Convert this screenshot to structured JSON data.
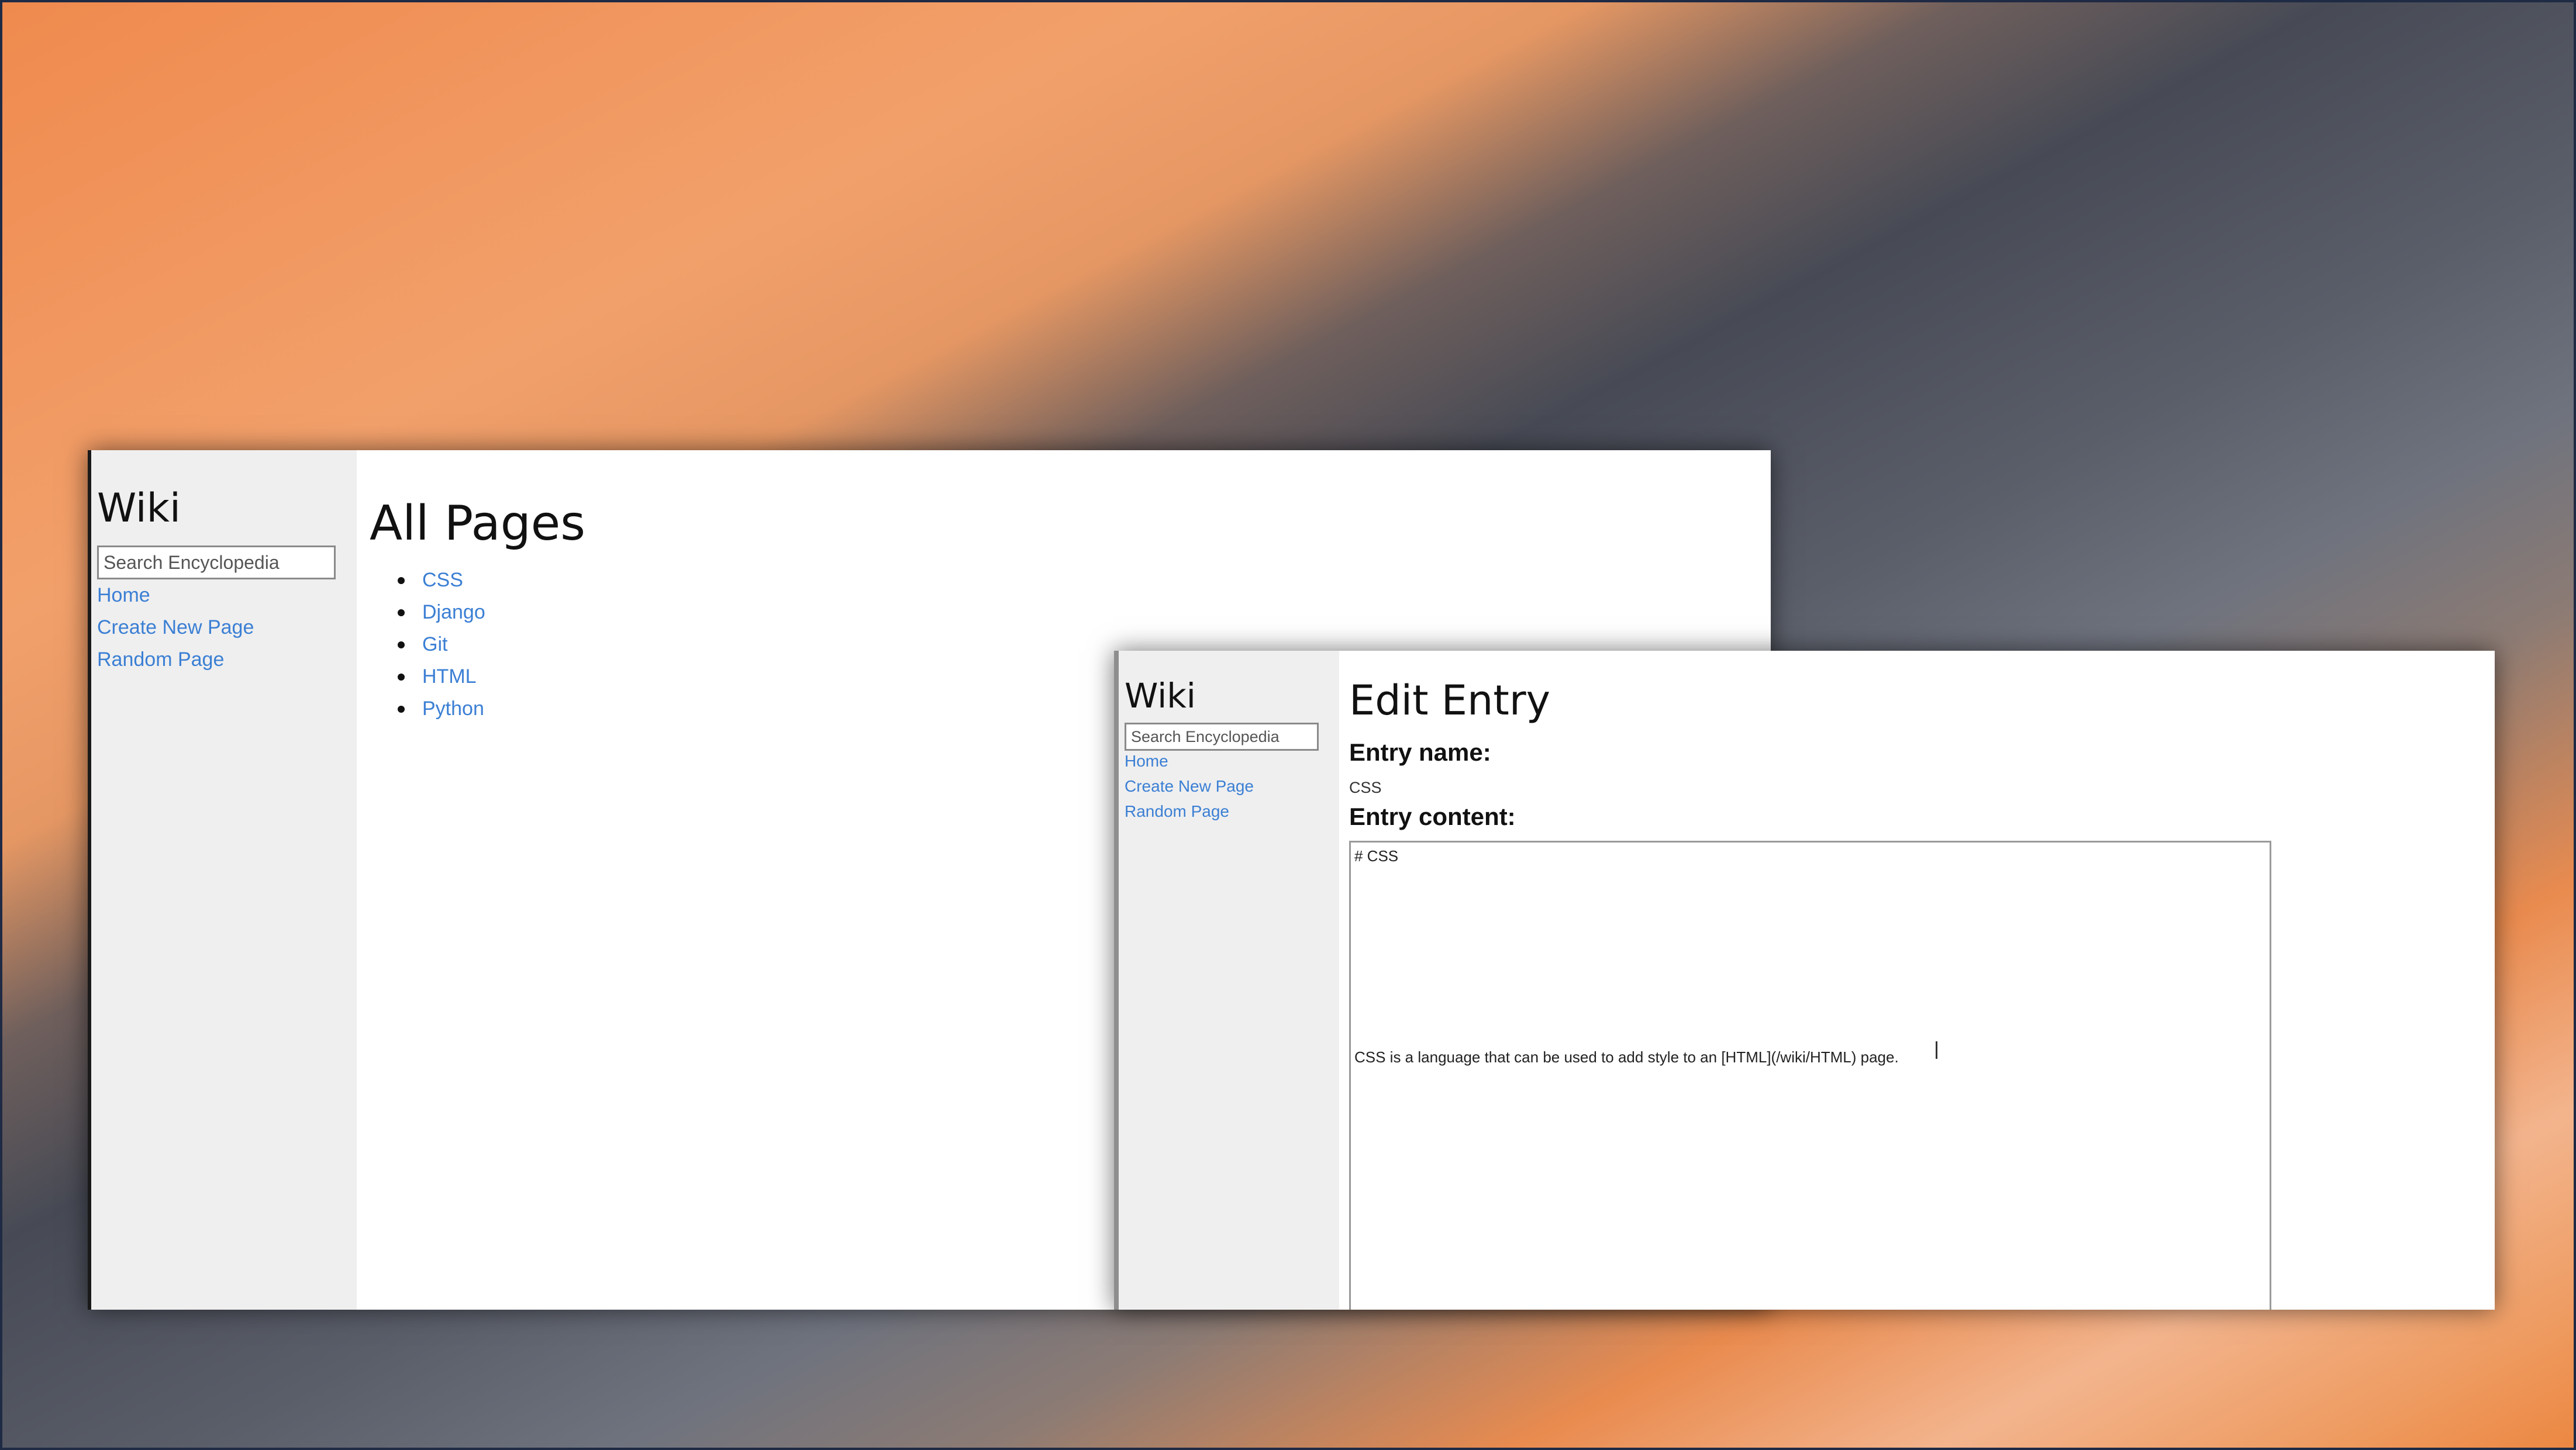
{
  "window_back": {
    "sidebar": {
      "logo": "Wiki",
      "search_placeholder": "Search Encyclopedia",
      "links": [
        "Home",
        "Create New Page",
        "Random Page"
      ]
    },
    "main": {
      "heading": "All Pages",
      "pages": [
        "CSS",
        "Django",
        "Git",
        "HTML",
        "Python"
      ]
    }
  },
  "window_front": {
    "sidebar": {
      "logo": "Wiki",
      "search_placeholder": "Search Encyclopedia",
      "links": [
        "Home",
        "Create New Page",
        "Random Page"
      ]
    },
    "main": {
      "heading": "Edit Entry",
      "name_label": "Entry name:",
      "name_value": "CSS",
      "content_label": "Entry content:",
      "content_line1": "# CSS",
      "content_line2": "CSS is a language that can be used to add style to an [HTML](/wiki/HTML) page."
    }
  },
  "colors": {
    "link": "#3b7fd4",
    "sidebar_bg": "#efefef"
  }
}
